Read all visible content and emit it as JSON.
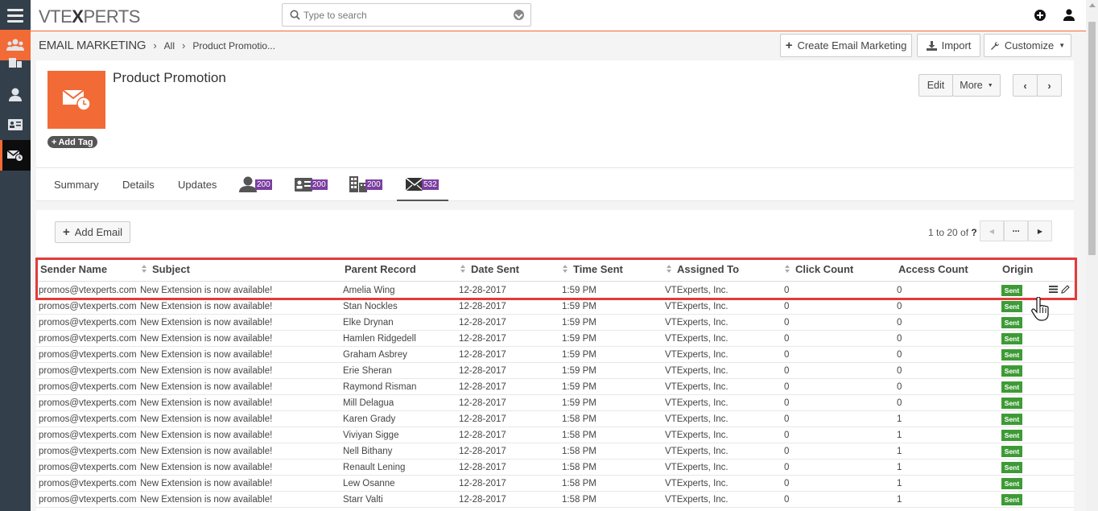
{
  "app": {
    "logo_prefix": "VTE",
    "logo_x": "X",
    "logo_suffix": "PERTS"
  },
  "search": {
    "placeholder": "Type to search"
  },
  "breadcrumb": {
    "module": "EMAIL MARKETING",
    "all": "All",
    "current": "Product Promotio..."
  },
  "toolbar": {
    "create": "Create Email Marketing",
    "import": "Import",
    "customize": "Customize"
  },
  "record": {
    "title": "Product Promotion",
    "add_tag": "Add Tag",
    "edit": "Edit",
    "more": "More"
  },
  "tabs": [
    {
      "label": "Summary"
    },
    {
      "label": "Details"
    },
    {
      "label": "Updates"
    },
    {
      "icon": "contacts-icon",
      "count": "200"
    },
    {
      "icon": "leads-icon",
      "count": "200"
    },
    {
      "icon": "accounts-icon",
      "count": "200"
    },
    {
      "icon": "email-icon",
      "count": "532"
    }
  ],
  "list": {
    "add_email": "Add Email",
    "pager_range": "1 to 20",
    "pager_of": "of",
    "pager_total": "?",
    "columns": [
      "Sender Name",
      "Subject",
      "Parent Record",
      "Date Sent",
      "Time Sent",
      "Assigned To",
      "Click Count",
      "Access Count",
      "Origin"
    ],
    "rows": [
      {
        "sender": "promos@vtexperts.com",
        "subject": "New Extension is now available!",
        "parent": "Amelia Wing",
        "date": "12-28-2017",
        "time": "1:59 PM",
        "assigned": "VTExperts, Inc.",
        "clicks": "0",
        "access": "0",
        "origin": "Sent"
      },
      {
        "sender": "promos@vtexperts.com",
        "subject": "New Extension is now available!",
        "parent": "Stan Nockles",
        "date": "12-28-2017",
        "time": "1:59 PM",
        "assigned": "VTExperts, Inc.",
        "clicks": "0",
        "access": "0",
        "origin": "Sent"
      },
      {
        "sender": "promos@vtexperts.com",
        "subject": "New Extension is now available!",
        "parent": "Elke Drynan",
        "date": "12-28-2017",
        "time": "1:59 PM",
        "assigned": "VTExperts, Inc.",
        "clicks": "0",
        "access": "0",
        "origin": "Sent"
      },
      {
        "sender": "promos@vtexperts.com",
        "subject": "New Extension is now available!",
        "parent": "Hamlen Ridgedell",
        "date": "12-28-2017",
        "time": "1:59 PM",
        "assigned": "VTExperts, Inc.",
        "clicks": "0",
        "access": "0",
        "origin": "Sent"
      },
      {
        "sender": "promos@vtexperts.com",
        "subject": "New Extension is now available!",
        "parent": "Graham Asbrey",
        "date": "12-28-2017",
        "time": "1:59 PM",
        "assigned": "VTExperts, Inc.",
        "clicks": "0",
        "access": "0",
        "origin": "Sent"
      },
      {
        "sender": "promos@vtexperts.com",
        "subject": "New Extension is now available!",
        "parent": "Erie Sheran",
        "date": "12-28-2017",
        "time": "1:59 PM",
        "assigned": "VTExperts, Inc.",
        "clicks": "0",
        "access": "0",
        "origin": "Sent"
      },
      {
        "sender": "promos@vtexperts.com",
        "subject": "New Extension is now available!",
        "parent": "Raymond Risman",
        "date": "12-28-2017",
        "time": "1:59 PM",
        "assigned": "VTExperts, Inc.",
        "clicks": "0",
        "access": "0",
        "origin": "Sent"
      },
      {
        "sender": "promos@vtexperts.com",
        "subject": "New Extension is now available!",
        "parent": "Mill Delagua",
        "date": "12-28-2017",
        "time": "1:59 PM",
        "assigned": "VTExperts, Inc.",
        "clicks": "0",
        "access": "0",
        "origin": "Sent"
      },
      {
        "sender": "promos@vtexperts.com",
        "subject": "New Extension is now available!",
        "parent": "Karen Grady",
        "date": "12-28-2017",
        "time": "1:58 PM",
        "assigned": "VTExperts, Inc.",
        "clicks": "0",
        "access": "1",
        "origin": "Sent"
      },
      {
        "sender": "promos@vtexperts.com",
        "subject": "New Extension is now available!",
        "parent": "Viviyan Sigge",
        "date": "12-28-2017",
        "time": "1:58 PM",
        "assigned": "VTExperts, Inc.",
        "clicks": "0",
        "access": "1",
        "origin": "Sent"
      },
      {
        "sender": "promos@vtexperts.com",
        "subject": "New Extension is now available!",
        "parent": "Nell Bithany",
        "date": "12-28-2017",
        "time": "1:58 PM",
        "assigned": "VTExperts, Inc.",
        "clicks": "0",
        "access": "1",
        "origin": "Sent"
      },
      {
        "sender": "promos@vtexperts.com",
        "subject": "New Extension is now available!",
        "parent": "Renault Lening",
        "date": "12-28-2017",
        "time": "1:58 PM",
        "assigned": "VTExperts, Inc.",
        "clicks": "0",
        "access": "1",
        "origin": "Sent"
      },
      {
        "sender": "promos@vtexperts.com",
        "subject": "New Extension is now available!",
        "parent": "Lew Osanne",
        "date": "12-28-2017",
        "time": "1:58 PM",
        "assigned": "VTExperts, Inc.",
        "clicks": "0",
        "access": "1",
        "origin": "Sent"
      },
      {
        "sender": "promos@vtexperts.com",
        "subject": "New Extension is now available!",
        "parent": "Starr Valti",
        "date": "12-28-2017",
        "time": "1:58 PM",
        "assigned": "VTExperts, Inc.",
        "clicks": "0",
        "access": "1",
        "origin": "Sent"
      }
    ]
  },
  "colors": {
    "accent": "#f26a35",
    "rail": "#333f4b",
    "badge": "#7b3fa0",
    "sent": "#3d9b35",
    "highlight": "#e23b3b"
  }
}
